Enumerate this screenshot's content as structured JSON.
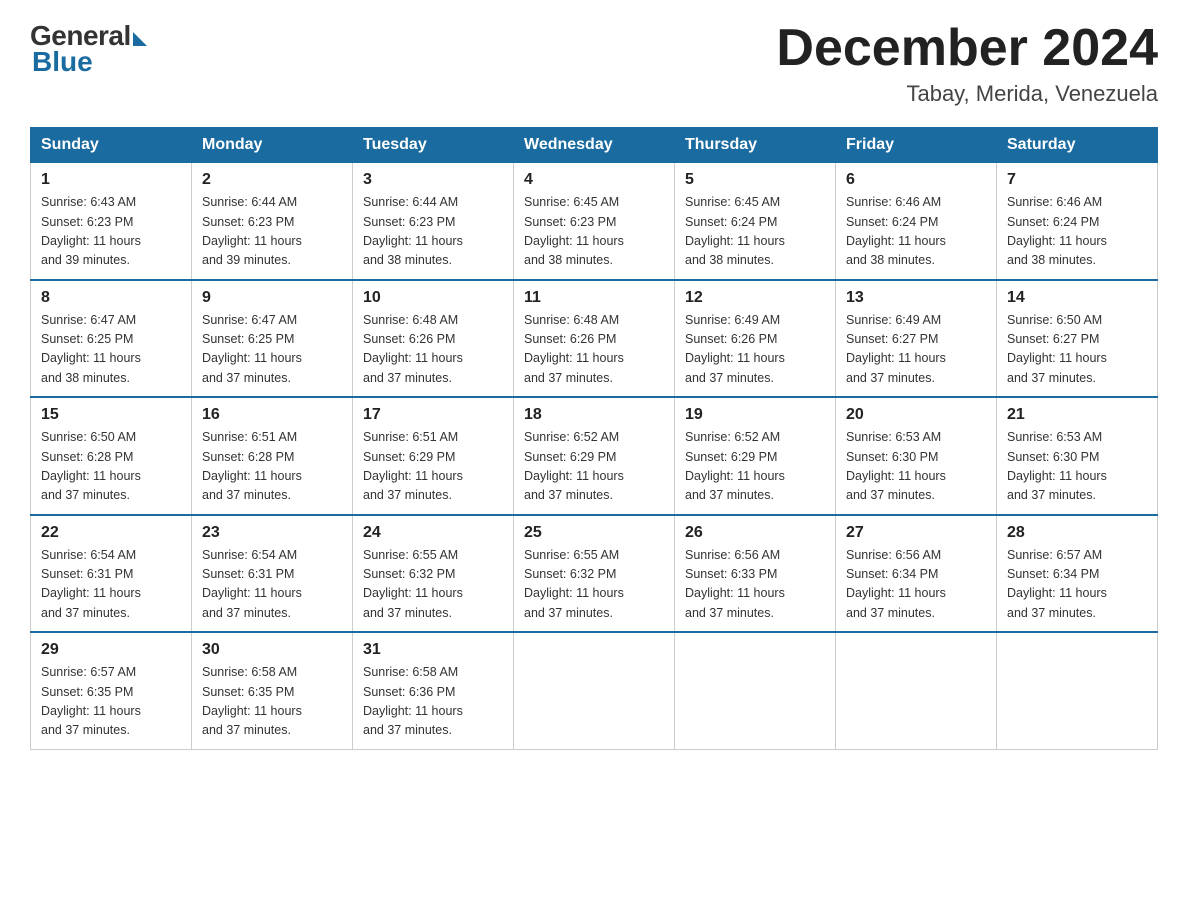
{
  "header": {
    "logo_general": "General",
    "logo_blue": "Blue",
    "month_title": "December 2024",
    "location": "Tabay, Merida, Venezuela"
  },
  "weekdays": [
    "Sunday",
    "Monday",
    "Tuesday",
    "Wednesday",
    "Thursday",
    "Friday",
    "Saturday"
  ],
  "weeks": [
    [
      {
        "day": "1",
        "sunrise": "6:43 AM",
        "sunset": "6:23 PM",
        "daylight": "11 hours and 39 minutes."
      },
      {
        "day": "2",
        "sunrise": "6:44 AM",
        "sunset": "6:23 PM",
        "daylight": "11 hours and 39 minutes."
      },
      {
        "day": "3",
        "sunrise": "6:44 AM",
        "sunset": "6:23 PM",
        "daylight": "11 hours and 38 minutes."
      },
      {
        "day": "4",
        "sunrise": "6:45 AM",
        "sunset": "6:23 PM",
        "daylight": "11 hours and 38 minutes."
      },
      {
        "day": "5",
        "sunrise": "6:45 AM",
        "sunset": "6:24 PM",
        "daylight": "11 hours and 38 minutes."
      },
      {
        "day": "6",
        "sunrise": "6:46 AM",
        "sunset": "6:24 PM",
        "daylight": "11 hours and 38 minutes."
      },
      {
        "day": "7",
        "sunrise": "6:46 AM",
        "sunset": "6:24 PM",
        "daylight": "11 hours and 38 minutes."
      }
    ],
    [
      {
        "day": "8",
        "sunrise": "6:47 AM",
        "sunset": "6:25 PM",
        "daylight": "11 hours and 38 minutes."
      },
      {
        "day": "9",
        "sunrise": "6:47 AM",
        "sunset": "6:25 PM",
        "daylight": "11 hours and 37 minutes."
      },
      {
        "day": "10",
        "sunrise": "6:48 AM",
        "sunset": "6:26 PM",
        "daylight": "11 hours and 37 minutes."
      },
      {
        "day": "11",
        "sunrise": "6:48 AM",
        "sunset": "6:26 PM",
        "daylight": "11 hours and 37 minutes."
      },
      {
        "day": "12",
        "sunrise": "6:49 AM",
        "sunset": "6:26 PM",
        "daylight": "11 hours and 37 minutes."
      },
      {
        "day": "13",
        "sunrise": "6:49 AM",
        "sunset": "6:27 PM",
        "daylight": "11 hours and 37 minutes."
      },
      {
        "day": "14",
        "sunrise": "6:50 AM",
        "sunset": "6:27 PM",
        "daylight": "11 hours and 37 minutes."
      }
    ],
    [
      {
        "day": "15",
        "sunrise": "6:50 AM",
        "sunset": "6:28 PM",
        "daylight": "11 hours and 37 minutes."
      },
      {
        "day": "16",
        "sunrise": "6:51 AM",
        "sunset": "6:28 PM",
        "daylight": "11 hours and 37 minutes."
      },
      {
        "day": "17",
        "sunrise": "6:51 AM",
        "sunset": "6:29 PM",
        "daylight": "11 hours and 37 minutes."
      },
      {
        "day": "18",
        "sunrise": "6:52 AM",
        "sunset": "6:29 PM",
        "daylight": "11 hours and 37 minutes."
      },
      {
        "day": "19",
        "sunrise": "6:52 AM",
        "sunset": "6:29 PM",
        "daylight": "11 hours and 37 minutes."
      },
      {
        "day": "20",
        "sunrise": "6:53 AM",
        "sunset": "6:30 PM",
        "daylight": "11 hours and 37 minutes."
      },
      {
        "day": "21",
        "sunrise": "6:53 AM",
        "sunset": "6:30 PM",
        "daylight": "11 hours and 37 minutes."
      }
    ],
    [
      {
        "day": "22",
        "sunrise": "6:54 AM",
        "sunset": "6:31 PM",
        "daylight": "11 hours and 37 minutes."
      },
      {
        "day": "23",
        "sunrise": "6:54 AM",
        "sunset": "6:31 PM",
        "daylight": "11 hours and 37 minutes."
      },
      {
        "day": "24",
        "sunrise": "6:55 AM",
        "sunset": "6:32 PM",
        "daylight": "11 hours and 37 minutes."
      },
      {
        "day": "25",
        "sunrise": "6:55 AM",
        "sunset": "6:32 PM",
        "daylight": "11 hours and 37 minutes."
      },
      {
        "day": "26",
        "sunrise": "6:56 AM",
        "sunset": "6:33 PM",
        "daylight": "11 hours and 37 minutes."
      },
      {
        "day": "27",
        "sunrise": "6:56 AM",
        "sunset": "6:34 PM",
        "daylight": "11 hours and 37 minutes."
      },
      {
        "day": "28",
        "sunrise": "6:57 AM",
        "sunset": "6:34 PM",
        "daylight": "11 hours and 37 minutes."
      }
    ],
    [
      {
        "day": "29",
        "sunrise": "6:57 AM",
        "sunset": "6:35 PM",
        "daylight": "11 hours and 37 minutes."
      },
      {
        "day": "30",
        "sunrise": "6:58 AM",
        "sunset": "6:35 PM",
        "daylight": "11 hours and 37 minutes."
      },
      {
        "day": "31",
        "sunrise": "6:58 AM",
        "sunset": "6:36 PM",
        "daylight": "11 hours and 37 minutes."
      },
      null,
      null,
      null,
      null
    ]
  ]
}
